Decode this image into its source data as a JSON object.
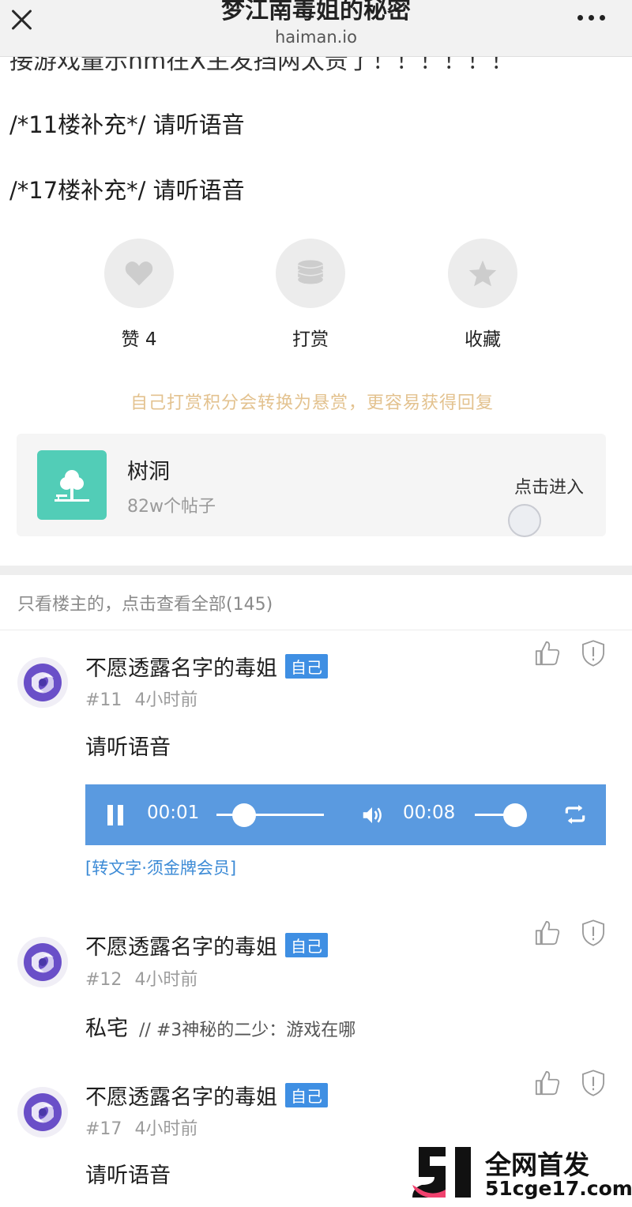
{
  "topbar": {
    "title": "梦江南毒姐的秘密",
    "domain": "haiman.io"
  },
  "post": {
    "partial_line": "接游戏量示hm在X主发挡两太贵了！！！！！！",
    "supplements": [
      "/*11楼补充*/ 请听语音",
      "/*17楼补充*/ 请听语音"
    ],
    "actions": {
      "like": {
        "label": "赞 4",
        "icon": "heart-icon"
      },
      "reward": {
        "label": "打赏",
        "icon": "coins-icon"
      },
      "favorite": {
        "label": "收藏",
        "icon": "star-icon"
      }
    },
    "tip": "自己打赏积分会转换为悬赏，更容易获得回复"
  },
  "forum": {
    "name": "树洞",
    "count": "82w个帖子",
    "enter_label": "点击进入",
    "icon": "tree-icon",
    "icon_color": "#52cdb7"
  },
  "filter": {
    "text": "只看楼主的，点击查看全部(145)"
  },
  "comments": [
    {
      "author": "不愿透露名字的毒姐",
      "badge": "自己",
      "floor": "#11",
      "time": "4小时前",
      "text": "请听语音",
      "audio": {
        "current": "00:01",
        "duration": "00:08",
        "progress": 0.125,
        "volume": 0.8
      },
      "transcribe": "[转文字·须金牌会员]"
    },
    {
      "author": "不愿透露名字的毒姐",
      "badge": "自己",
      "floor": "#12",
      "time": "4小时前",
      "text": "私宅",
      "quote": "// #3神秘的二少：游戏在哪"
    },
    {
      "author": "不愿透露名字的毒姐",
      "badge": "自己",
      "floor": "#17",
      "time": "4小时前",
      "text": "请听语音"
    }
  ],
  "watermark": {
    "title": "全网首发",
    "site": "51cge17.com"
  },
  "colors": {
    "accent_blue": "#3f8fe3",
    "player_blue": "#5a9ae0",
    "tip_gold": "#e3c28f"
  }
}
